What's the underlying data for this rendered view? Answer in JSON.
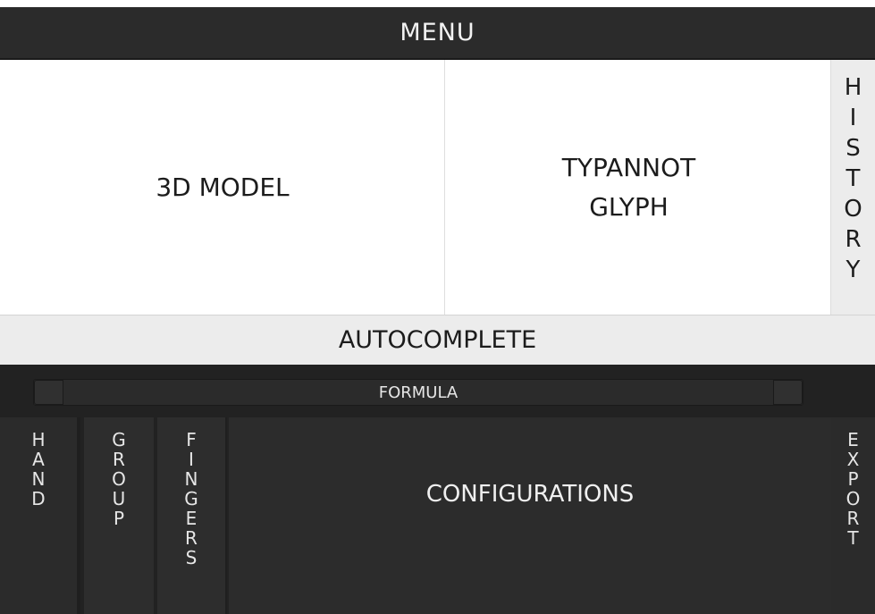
{
  "menu": {
    "label": "MENU"
  },
  "panels": {
    "model_label": "3D MODEL",
    "glyph_label_line1": "TYPANNOT",
    "glyph_label_line2": "GLYPH"
  },
  "history": {
    "label": "HISTORY"
  },
  "autocomplete": {
    "label": "AUTOCOMPLETE"
  },
  "formula": {
    "label": "FORMULA"
  },
  "columns": {
    "hand": "HAND",
    "group": "GROUP",
    "fingers": "FINGERS",
    "export": "EXPORT"
  },
  "configurations": {
    "label": "CONFIGURATIONS"
  }
}
